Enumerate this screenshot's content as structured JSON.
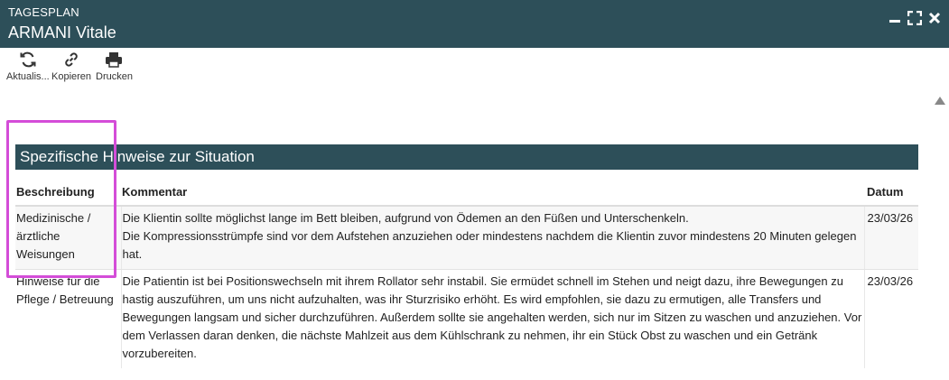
{
  "window": {
    "subtitle": "TAGESPLAN",
    "title": "ARMANI Vitale",
    "controls": [
      "minimize-icon",
      "maximize-icon",
      "close-icon"
    ]
  },
  "toolbar": {
    "refresh_label": "Aktualis...",
    "copy_label": "Kopieren",
    "print_label": "Drucken"
  },
  "section": {
    "title": "Spezifische Hinweise zur Situation"
  },
  "table": {
    "headers": {
      "description": "Beschreibung",
      "comment": "Kommentar",
      "date": "Datum"
    },
    "rows": [
      {
        "description": "Medizinische / ärztliche Weisungen",
        "comment_lines": [
          "Die Klientin sollte möglichst lange im Bett bleiben, aufgrund von Ödemen an den Füßen und Unterschenkeln.",
          "Die Kompressionsstrümpfe sind vor dem Aufstehen anzuziehen oder mindestens nachdem die Klientin zuvor mindestens 20 Minuten gelegen hat."
        ],
        "date": "23/03/26"
      },
      {
        "description": "Hinweise für die Pflege / Betreuung",
        "comment_lines": [
          "Die Patientin ist bei Positionswechseln mit ihrem Rollator sehr instabil. Sie ermüdet schnell im Stehen und neigt dazu, ihre Bewegungen zu hastig auszuführen, um uns nicht aufzuhalten, was ihr Sturzrisiko erhöht. Es wird empfohlen, sie dazu zu ermutigen, alle Transfers und Bewegungen langsam und sicher durchzuführen. Außerdem sollte sie angehalten werden, sich nur im Sitzen zu waschen und anzuziehen. Vor dem Verlassen daran denken, die nächste Mahlzeit aus dem Kühlschrank zu nehmen, ihr ein Stück Obst zu waschen und ein Getränk vorzubereiten."
        ],
        "date": "23/03/26"
      }
    ]
  },
  "colors": {
    "header_bg": "#2d4f59",
    "highlight": "#d44dd8"
  }
}
